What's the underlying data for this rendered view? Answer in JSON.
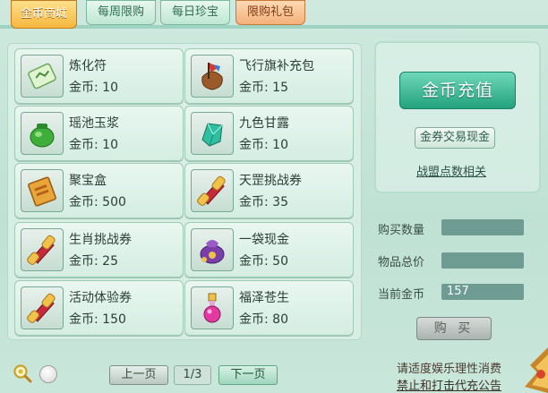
{
  "tabs": [
    {
      "label": "金币商城"
    },
    {
      "label": "每周限购"
    },
    {
      "label": "每日珍宝"
    },
    {
      "label": "限购礼包"
    }
  ],
  "items": [
    {
      "name": "炼化符",
      "price_label": "金币:",
      "price": "10",
      "icon": "talisman-icon"
    },
    {
      "name": "飞行旗补充包",
      "price_label": "金币:",
      "price": "15",
      "icon": "flag-bag-icon"
    },
    {
      "name": "瑶池玉浆",
      "price_label": "金币:",
      "price": "10",
      "icon": "jade-jar-icon"
    },
    {
      "name": "九色甘露",
      "price_label": "金币:",
      "price": "10",
      "icon": "gem-crystal-icon"
    },
    {
      "name": "聚宝盒",
      "price_label": "金币:",
      "price": "500",
      "icon": "treasure-box-icon"
    },
    {
      "name": "天罡挑战券",
      "price_label": "金币:",
      "price": "35",
      "icon": "scroll-icon"
    },
    {
      "name": "生肖挑战券",
      "price_label": "金币:",
      "price": "25",
      "icon": "scroll-icon"
    },
    {
      "name": "一袋现金",
      "price_label": "金币:",
      "price": "50",
      "icon": "money-bag-icon"
    },
    {
      "name": "活动体验券",
      "price_label": "金币:",
      "price": "150",
      "icon": "scroll-icon"
    },
    {
      "name": "福泽苍生",
      "price_label": "金币:",
      "price": "80",
      "icon": "potion-bottle-icon"
    }
  ],
  "right": {
    "recharge_label": "金币充值",
    "trade_label": "金券交易现金",
    "alliance_label": "战盟点数相关"
  },
  "form": {
    "qty_label": "购买数量",
    "qty_value": "",
    "total_label": "物品总价",
    "total_value": "",
    "gold_label": "当前金币",
    "gold_value": "157",
    "buy_label": "购 买"
  },
  "pagination": {
    "prev_label": "上一页",
    "page": "1/3",
    "next_label": "下一页"
  },
  "footer": {
    "line1": "请适度娱乐理性消费",
    "line2": "禁止和打击代充公告"
  },
  "colors": {
    "accent_green": "#23a27e",
    "tab_active": "#f6b73e",
    "tab_gift": "#f2b27b"
  }
}
